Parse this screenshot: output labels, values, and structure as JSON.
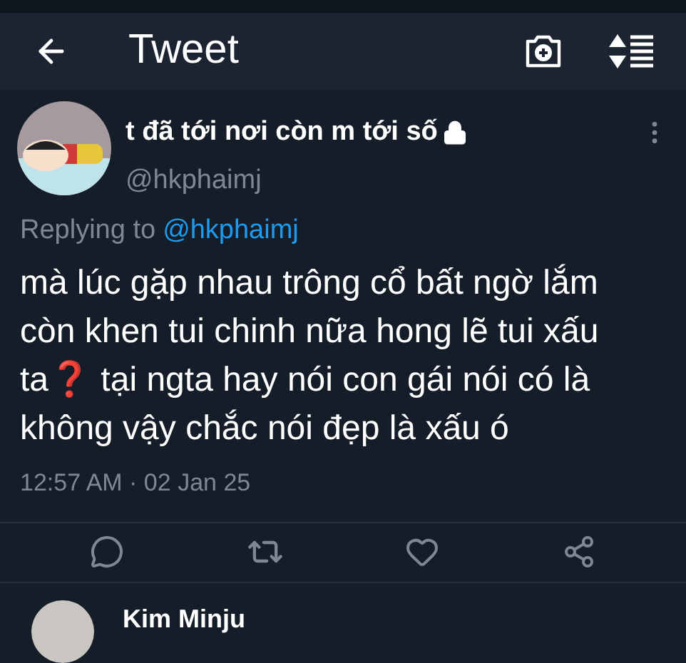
{
  "header": {
    "title": "Tweet"
  },
  "tweet": {
    "display_name": "t đã tới nơi còn m tới số",
    "protected": true,
    "handle": "@hkphaimj",
    "replying_prefix": "Replying to",
    "replying_to": "@hkphaimj",
    "text": "mà lúc gặp nhau trông cổ bất ngờ lắm còn khen tui chinh nữa hong lẽ tui xấu ta❓ tại ngta hay nói con gái nói có là không vậy chắc nói đẹp là xấu ó",
    "timestamp": "12:57 AM · 02 Jan 25"
  },
  "next_tweet": {
    "text": "Kim Minju"
  }
}
